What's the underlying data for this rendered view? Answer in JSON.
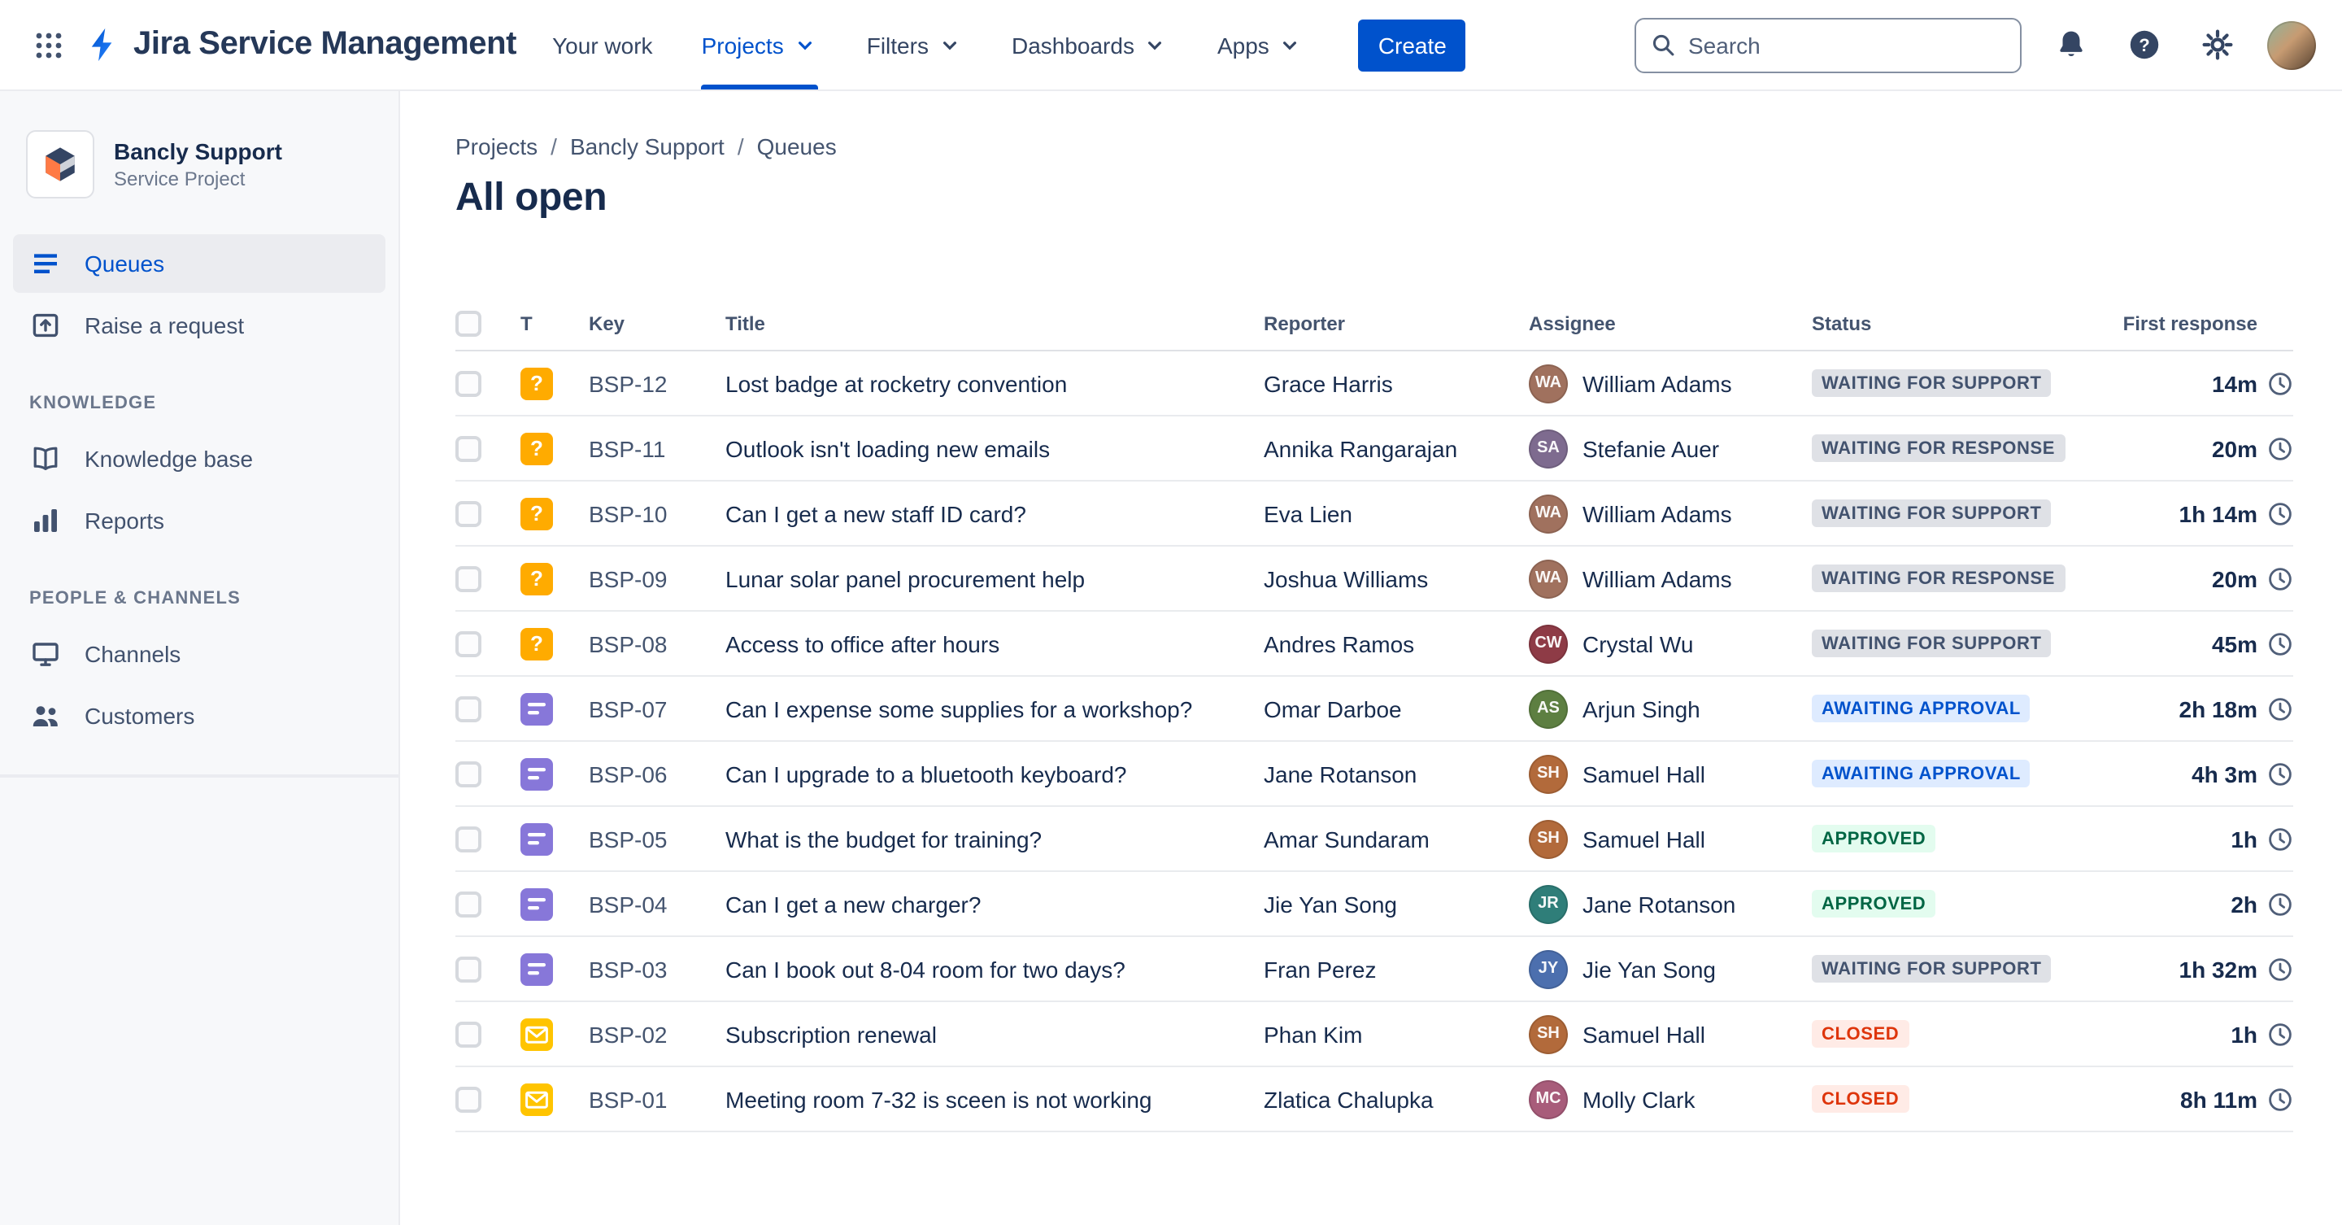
{
  "theme": {
    "accent_blue": "#0052CC",
    "status_colors": {
      "gray": {
        "bg": "#DFE1E6",
        "text": "#42526E"
      },
      "blue": {
        "bg": "#DEEBFF",
        "text": "#0052CC"
      },
      "green": {
        "bg": "#E3FCEF",
        "text": "#006644"
      },
      "red": {
        "bg": "#FFEBE6",
        "text": "#DE350B"
      }
    },
    "type_icon_colors": {
      "question": "#FFAB00",
      "request": "#8777D9",
      "email": "#FFC400"
    }
  },
  "icons": {
    "question_glyph": "?"
  },
  "navbar": {
    "app_title": "Jira Service Management",
    "items": [
      {
        "label": "Your work",
        "has_dropdown": false,
        "active": false
      },
      {
        "label": "Projects",
        "has_dropdown": true,
        "active": true
      },
      {
        "label": "Filters",
        "has_dropdown": true,
        "active": false
      },
      {
        "label": "Dashboards",
        "has_dropdown": true,
        "active": false
      },
      {
        "label": "Apps",
        "has_dropdown": true,
        "active": false
      }
    ],
    "create_label": "Create",
    "search_placeholder": "Search"
  },
  "sidebar": {
    "project_name": "Bancly Support",
    "project_type": "Service Project",
    "items": [
      {
        "label": "Queues",
        "icon": "queues-icon",
        "active": true
      },
      {
        "label": "Raise a request",
        "icon": "raise-request-icon",
        "active": false
      }
    ],
    "sections": [
      {
        "title": "KNOWLEDGE",
        "items": [
          {
            "label": "Knowledge base",
            "icon": "book-icon"
          },
          {
            "label": "Reports",
            "icon": "bar-chart-icon"
          }
        ]
      },
      {
        "title": "PEOPLE & CHANNELS",
        "items": [
          {
            "label": "Channels",
            "icon": "monitor-icon"
          },
          {
            "label": "Customers",
            "icon": "people-icon"
          }
        ]
      }
    ]
  },
  "main": {
    "breadcrumb": [
      "Projects",
      "Bancly Support",
      "Queues"
    ],
    "page_title": "All open",
    "table": {
      "columns": [
        "",
        "T",
        "Key",
        "Title",
        "Reporter",
        "Assignee",
        "Status",
        "First response"
      ],
      "rows": [
        {
          "key": "BSP-12",
          "type": "question",
          "title": "Lost badge at rocketry convention",
          "reporter": "Grace Harris",
          "assignee": "William Adams",
          "avatar_color": "#A0715E",
          "status": "WAITING FOR SUPPORT",
          "status_kind": "gray",
          "first_response": "14m"
        },
        {
          "key": "BSP-11",
          "type": "question",
          "title": "Outlook isn't loading new emails",
          "reporter": "Annika Rangarajan",
          "assignee": "Stefanie Auer",
          "avatar_color": "#7E6B8F",
          "status": "WAITING FOR RESPONSE",
          "status_kind": "gray",
          "first_response": "20m"
        },
        {
          "key": "BSP-10",
          "type": "question",
          "title": "Can I get a new staff ID card?",
          "reporter": "Eva Lien",
          "assignee": "William Adams",
          "avatar_color": "#A0715E",
          "status": "WAITING FOR SUPPORT",
          "status_kind": "gray",
          "first_response": "1h 14m"
        },
        {
          "key": "BSP-09",
          "type": "question",
          "title": "Lunar solar panel procurement help",
          "reporter": "Joshua Williams",
          "assignee": "William Adams",
          "avatar_color": "#A0715E",
          "status": "WAITING FOR RESPONSE",
          "status_kind": "gray",
          "first_response": "20m"
        },
        {
          "key": "BSP-08",
          "type": "question",
          "title": "Access to office after hours",
          "reporter": "Andres Ramos",
          "assignee": "Crystal Wu",
          "avatar_color": "#8E3B46",
          "status": "WAITING FOR SUPPORT",
          "status_kind": "gray",
          "first_response": "45m"
        },
        {
          "key": "BSP-07",
          "type": "request",
          "title": "Can I expense some supplies for a workshop?",
          "reporter": "Omar Darboe",
          "assignee": "Arjun Singh",
          "avatar_color": "#5D7F41",
          "status": "AWAITING APPROVAL",
          "status_kind": "blue",
          "first_response": "2h 18m"
        },
        {
          "key": "BSP-06",
          "type": "request",
          "title": "Can I upgrade to a bluetooth keyboard?",
          "reporter": "Jane Rotanson",
          "assignee": "Samuel Hall",
          "avatar_color": "#B26A3B",
          "status": "AWAITING APPROVAL",
          "status_kind": "blue",
          "first_response": "4h 3m"
        },
        {
          "key": "BSP-05",
          "type": "request",
          "title": "What is the budget for training?",
          "reporter": "Amar Sundaram",
          "assignee": "Samuel Hall",
          "avatar_color": "#B26A3B",
          "status": "APPROVED",
          "status_kind": "green",
          "first_response": "1h"
        },
        {
          "key": "BSP-04",
          "type": "request",
          "title": "Can I get a new charger?",
          "reporter": "Jie Yan Song",
          "assignee": "Jane Rotanson",
          "avatar_color": "#2F7E79",
          "status": "APPROVED",
          "status_kind": "green",
          "first_response": "2h"
        },
        {
          "key": "BSP-03",
          "type": "request",
          "title": "Can I book out 8-04 room for two days?",
          "reporter": "Fran Perez",
          "assignee": "Jie Yan Song",
          "avatar_color": "#4C6FAE",
          "status": "WAITING FOR SUPPORT",
          "status_kind": "gray",
          "first_response": "1h 32m"
        },
        {
          "key": "BSP-02",
          "type": "email",
          "title": "Subscription renewal",
          "reporter": "Phan Kim",
          "assignee": "Samuel Hall",
          "avatar_color": "#B26A3B",
          "status": "CLOSED",
          "status_kind": "red",
          "first_response": "1h"
        },
        {
          "key": "BSP-01",
          "type": "email",
          "title": "Meeting room 7-32 is sceen is not working",
          "reporter": "Zlatica Chalupka",
          "assignee": "Molly Clark",
          "avatar_color": "#A85C7A",
          "status": "CLOSED",
          "status_kind": "red",
          "first_response": "8h 11m"
        }
      ]
    }
  }
}
